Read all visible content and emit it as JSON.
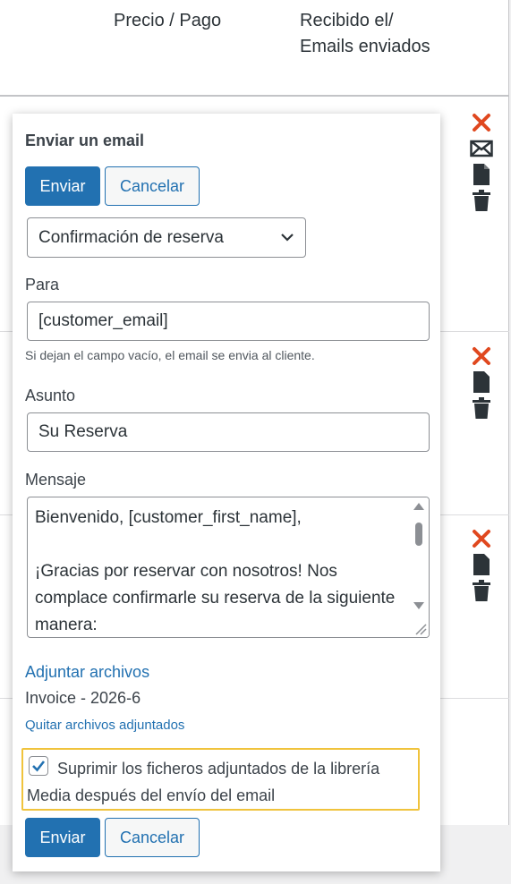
{
  "table": {
    "col_price": "Precio / Pago",
    "col_received_line1": "Recibido el/",
    "col_received_line2": "Emails enviados"
  },
  "row_action_icons": [
    [
      "close-icon",
      "envelope-icon",
      "document-icon",
      "trash-icon"
    ],
    [
      "close-icon",
      "document-icon",
      "trash-icon"
    ],
    [
      "close-icon",
      "document-icon",
      "trash-icon"
    ]
  ],
  "email_dialog": {
    "title": "Enviar un email",
    "send_label": "Enviar",
    "cancel_label": "Cancelar",
    "template_selected": "Confirmación de reserva",
    "to_label": "Para",
    "to_value": "[customer_email]",
    "to_hint": "Si dejan el campo vacío, el email se envia al cliente.",
    "subject_label": "Asunto",
    "subject_value": "Su Reserva",
    "message_label": "Mensaje",
    "message_line1": "Bienvenido, [customer_first_name],",
    "message_line2": "¡Gracias por reservar con nosotros! Nos complace confirmarle su reserva de la siguiente manera:",
    "attach_link": "Adjuntar archivos",
    "attachment_name": "Invoice - 2026-6",
    "remove_attachments": "Quitar archivos adjuntados",
    "suppress_checked": true,
    "suppress_label": "Suprimir los ficheros adjuntados de la librería Media después del envío del email",
    "send_label_bottom": "Enviar",
    "cancel_label_bottom": "Cancelar"
  },
  "colors": {
    "primary": "#2271b1",
    "danger": "#e0481f",
    "highlight": "#f0c33c"
  }
}
